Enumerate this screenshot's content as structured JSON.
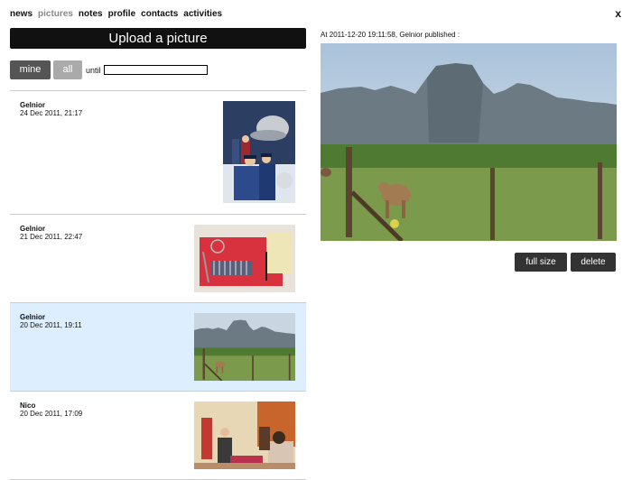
{
  "nav": {
    "items": [
      {
        "label": "news",
        "active": false
      },
      {
        "label": "pictures",
        "active": true
      },
      {
        "label": "notes",
        "active": false
      },
      {
        "label": "profile",
        "active": false
      },
      {
        "label": "contacts",
        "active": false
      },
      {
        "label": "activities",
        "active": false
      }
    ],
    "close_label": "x"
  },
  "upload_label": "Upload a picture",
  "filter": {
    "mine_label": "mine",
    "all_label": "all",
    "until_label": "until",
    "until_value": ""
  },
  "posts": [
    {
      "author": "Gelnior",
      "date": "24 Dec 2011, 21:17",
      "thumb": "illustration-spaceman-police",
      "selected": false
    },
    {
      "author": "Gelnior",
      "date": "21 Dec 2011, 22:47",
      "thumb": "red-placemat-table",
      "selected": false
    },
    {
      "author": "Gelnior",
      "date": "20 Dec 2011, 19:11",
      "thumb": "karst-landscape-cow",
      "selected": true
    },
    {
      "author": "Nico",
      "date": "20 Dec 2011, 17:09",
      "thumb": "indoor-people",
      "selected": false
    }
  ],
  "viewer": {
    "caption_prefix": "At 2011-12-20 19:11:58, ",
    "caption_author": "Gelnior",
    "caption_suffix": " published :",
    "image": "karst-landscape-cow",
    "full_size_label": "full size",
    "delete_label": "delete"
  }
}
